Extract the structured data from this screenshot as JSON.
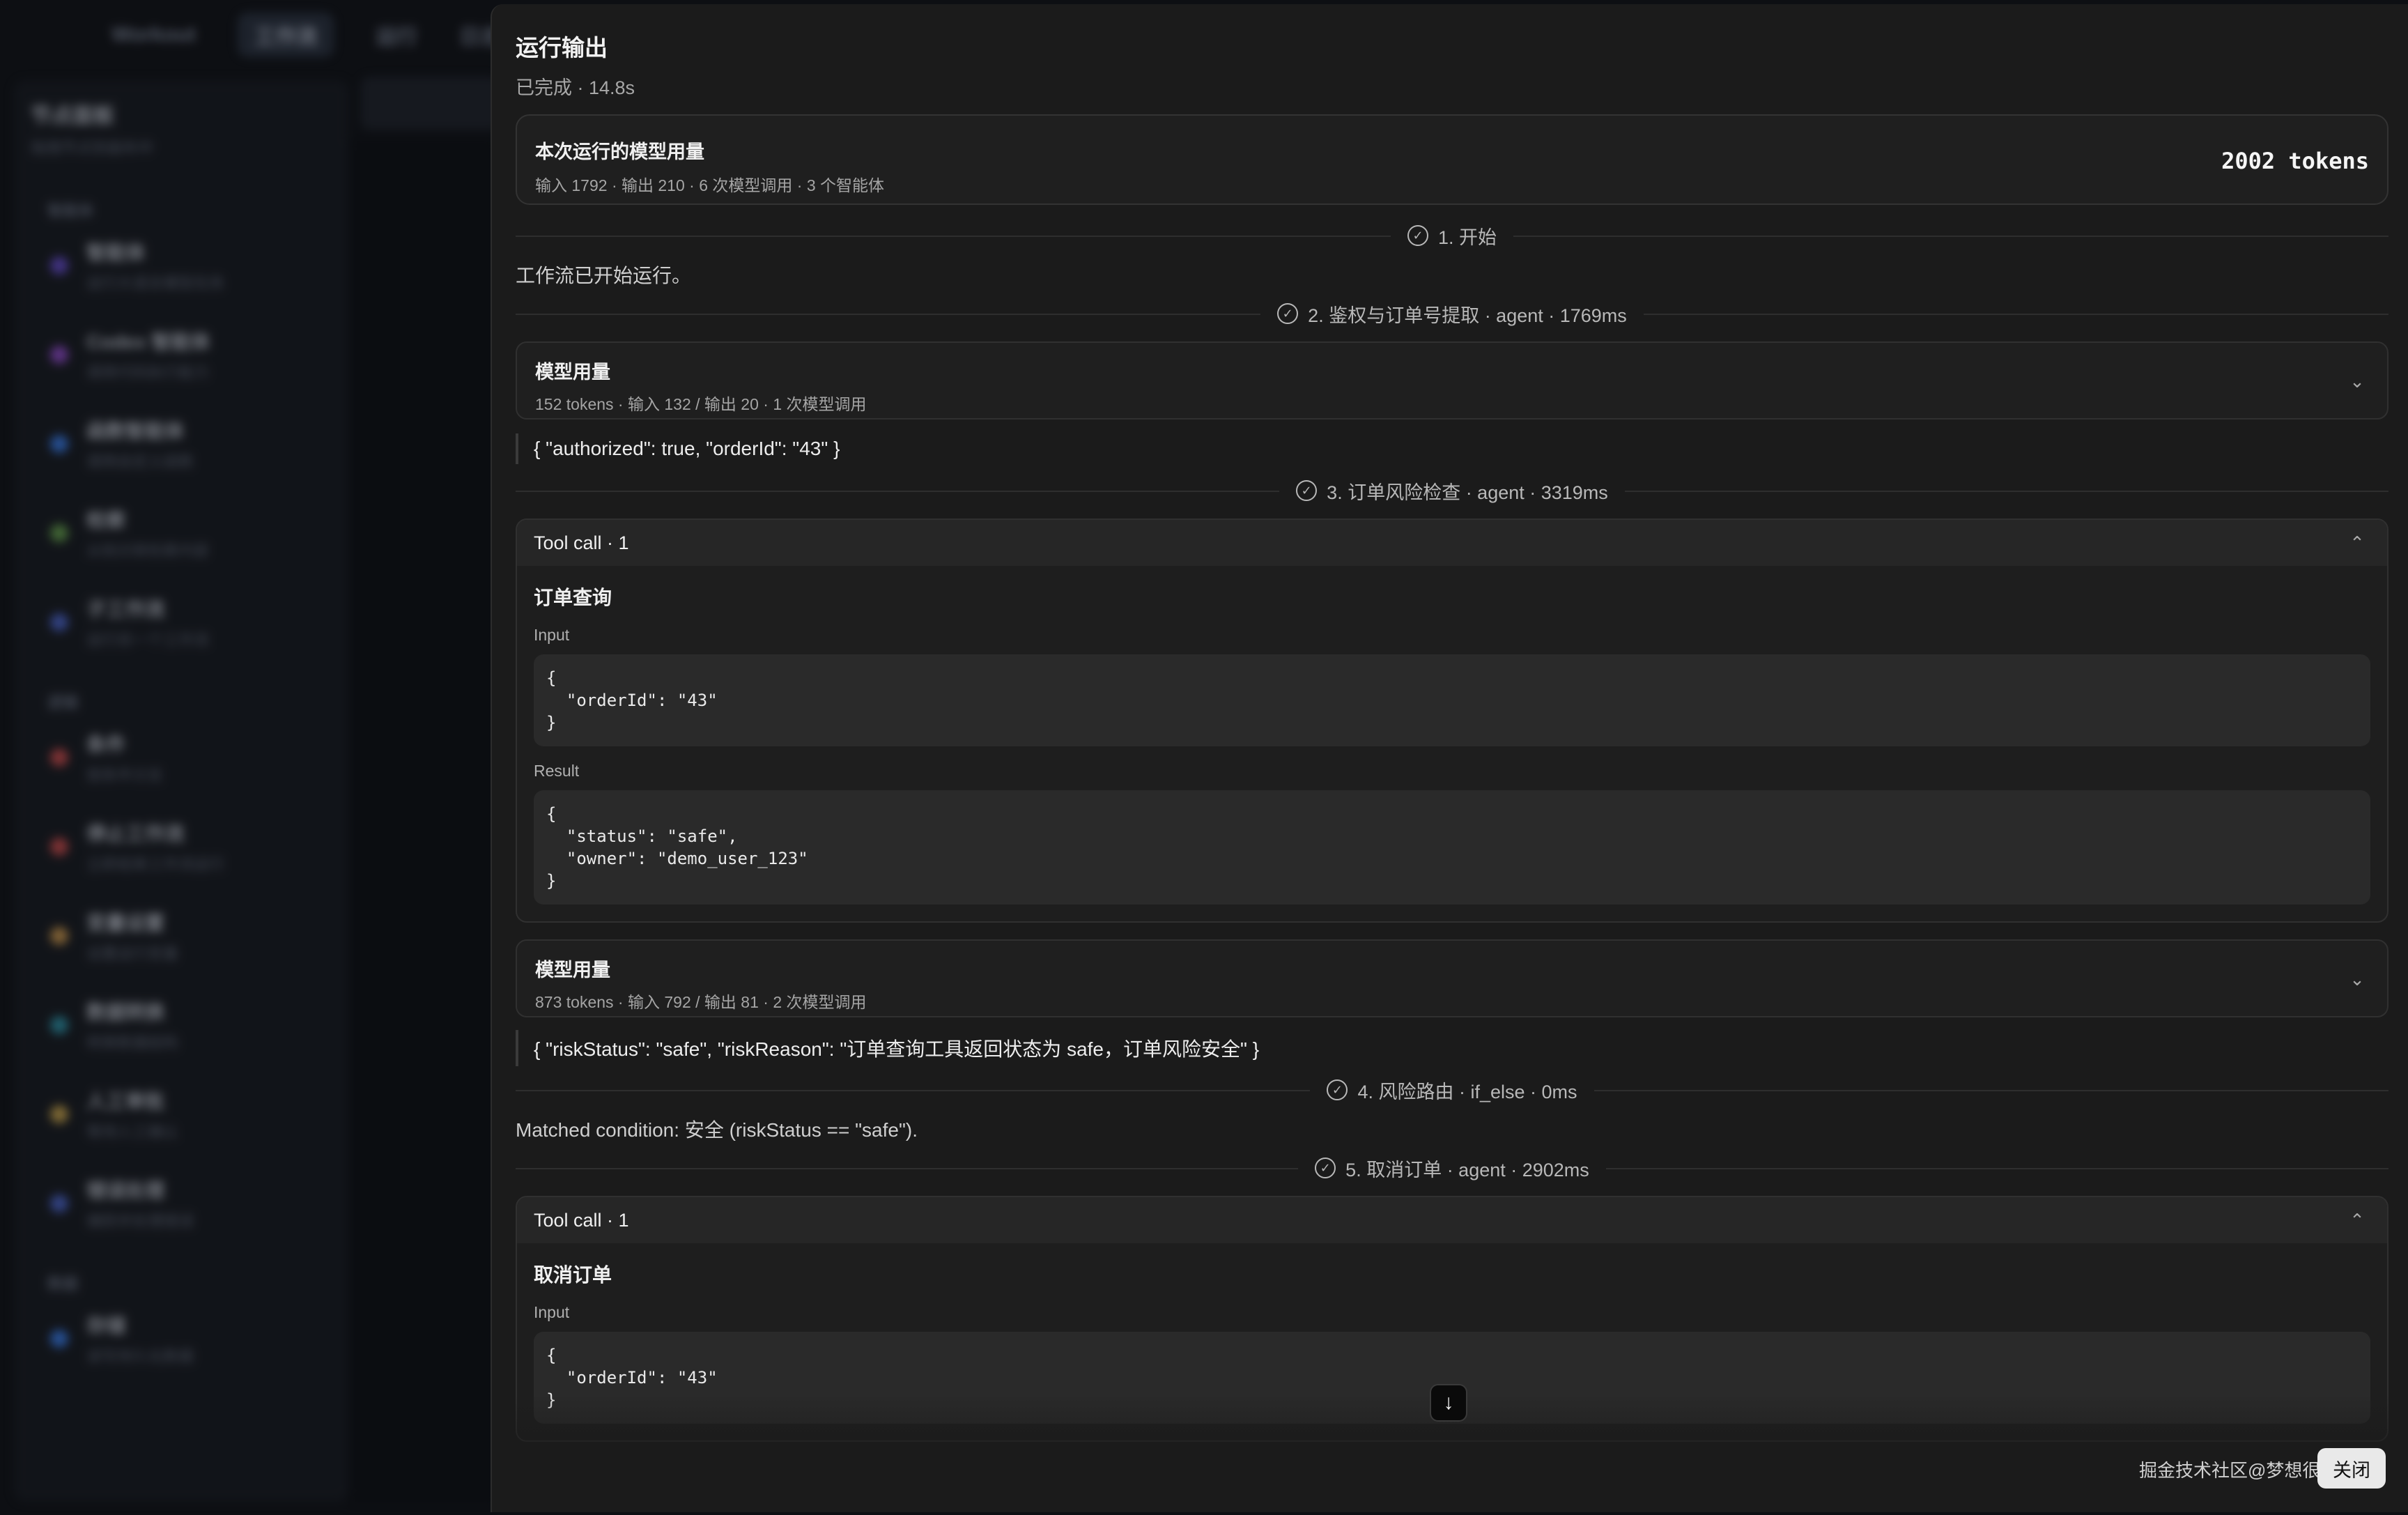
{
  "background": {
    "topbar": [
      "Workout",
      "工作流",
      "运行",
      "日志"
    ],
    "sidebar_title": "节点面板",
    "sidebar_subtitle": "拖拽节点到画布中",
    "sections": [
      {
        "label": "智能体",
        "items": [
          {
            "title": "智能体",
            "sub": "运行大语言模型任务",
            "color": "#6a4fd8"
          },
          {
            "title": "Codex 智能体",
            "sub": "调用代码执行能力",
            "color": "#9a4fd8"
          },
          {
            "title": "函数智能体",
            "sub": "调用自定义函数",
            "color": "#3b82f6"
          },
          {
            "title": "检索",
            "sub": "从知识库检索内容",
            "color": "#6aa84f"
          },
          {
            "title": "子工作流",
            "sub": "运行另一个工作流",
            "color": "#4f6ad8"
          }
        ]
      },
      {
        "label": "逻辑",
        "items": [
          {
            "title": "条件",
            "sub": "按条件分支",
            "color": "#d84f4f"
          },
          {
            "title": "停止工作流",
            "sub": "立即结束工作流运行",
            "color": "#d84f4f"
          },
          {
            "title": "变量设置",
            "sub": "设置运行变量",
            "color": "#d8a04f"
          },
          {
            "title": "数据转换",
            "sub": "转换数据结构",
            "color": "#2f9ab0"
          },
          {
            "title": "人工审批",
            "sub": "等待人工确认",
            "color": "#d8b04f"
          },
          {
            "title": "错误处理",
            "sub": "捕获并处理错误",
            "color": "#4f6ad8"
          }
        ]
      },
      {
        "label": "数据",
        "items": [
          {
            "title": "存储",
            "sub": "读写持久化数据",
            "color": "#3b82f6"
          }
        ]
      }
    ]
  },
  "panel": {
    "title": "运行输出",
    "status": "已完成 · 14.8s",
    "usage": {
      "title": "本次运行的模型用量",
      "sub": "输入 1792 · 输出 210 · 6 次模型调用 · 3 个智能体",
      "total": "2002 tokens"
    },
    "steps": {
      "s1": "1. 开始",
      "s1_text": "工作流已开始运行。",
      "s2": "2. 鉴权与订单号提取 · agent · 1769ms",
      "s2_usage_title": "模型用量",
      "s2_usage_sub": "152 tokens · 输入 132 / 输出 20 · 1 次模型调用",
      "s2_output": "{ \"authorized\": true, \"orderId\": \"43\" }",
      "s3": "3. 订单风险检查 · agent · 3319ms",
      "s3_tool_head": "Tool call · 1",
      "s3_tool_name": "订单查询",
      "s3_input_label": "Input",
      "s3_input_code": "{\n  \"orderId\": \"43\"\n}",
      "s3_result_label": "Result",
      "s3_result_code": "{\n  \"status\": \"safe\",\n  \"owner\": \"demo_user_123\"\n}",
      "s3_usage_title": "模型用量",
      "s3_usage_sub": "873 tokens · 输入 792 / 输出 81 · 2 次模型调用",
      "s3_output": "{ \"riskStatus\": \"safe\", \"riskReason\": \"订单查询工具返回状态为 safe，订单风险安全\" }",
      "s4": "4. 风险路由 · if_else · 0ms",
      "s4_text": "Matched condition: 安全 (riskStatus == \"safe\").",
      "s5": "5. 取消订单 · agent · 2902ms",
      "s5_tool_head": "Tool call · 1",
      "s5_tool_name": "取消订单",
      "s5_input_label": "Input",
      "s5_input_code": "{\n  \"orderId\": \"43\"\n}"
    },
    "watermark": "掘金技术社区@梦想很大很大",
    "close_label": "关闭"
  },
  "icons": {
    "check": "check-circle-icon",
    "chevron_down": "chevron-down-icon",
    "chevron_up": "chevron-up-icon",
    "arrow_down": "arrow-down-icon"
  }
}
